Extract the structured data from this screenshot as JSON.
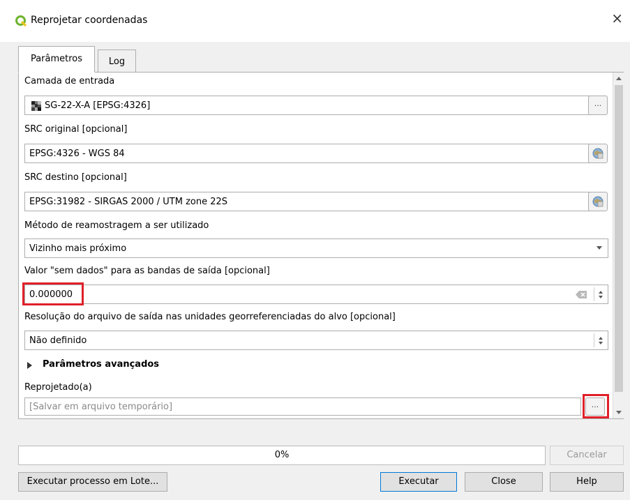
{
  "window": {
    "title": "Reprojetar coordenadas",
    "close_glyph": "×"
  },
  "tabs": [
    {
      "label": "Parâmetros",
      "active": true
    },
    {
      "label": "Log",
      "active": false
    }
  ],
  "form": {
    "input_layer": {
      "label": "Camada de entrada",
      "value": "SG-22-X-A [EPSG:4326]",
      "button": "..."
    },
    "source_crs": {
      "label": "SRC original [opcional]",
      "value": "EPSG:4326 - WGS 84"
    },
    "target_crs": {
      "label": "SRC destino [opcional]",
      "value": "EPSG:31982 - SIRGAS 2000 / UTM zone 22S"
    },
    "resampling": {
      "label": "Método de reamostragem a ser utilizado",
      "value": "Vizinho mais próximo"
    },
    "nodata": {
      "label": "Valor \"sem dados\" para as bandas de saída [opcional]",
      "value": "0.000000"
    },
    "resolution": {
      "label": "Resolução do arquivo de saída nas unidades georreferenciadas do alvo [opcional]",
      "value": "Não definido"
    },
    "advanced": {
      "label": "Parâmetros avançados"
    },
    "output": {
      "label": "Reprojetado(a)",
      "placeholder": "[Salvar em arquivo temporário]",
      "button": "..."
    }
  },
  "progress": {
    "text": "0%",
    "value": 0
  },
  "buttons": {
    "cancel": "Cancelar",
    "batch": "Executar processo em Lote...",
    "run": "Executar",
    "close": "Close",
    "help": "Help"
  },
  "colors": {
    "highlight": "#e0202a",
    "qgis_green": "#6fb32e"
  }
}
